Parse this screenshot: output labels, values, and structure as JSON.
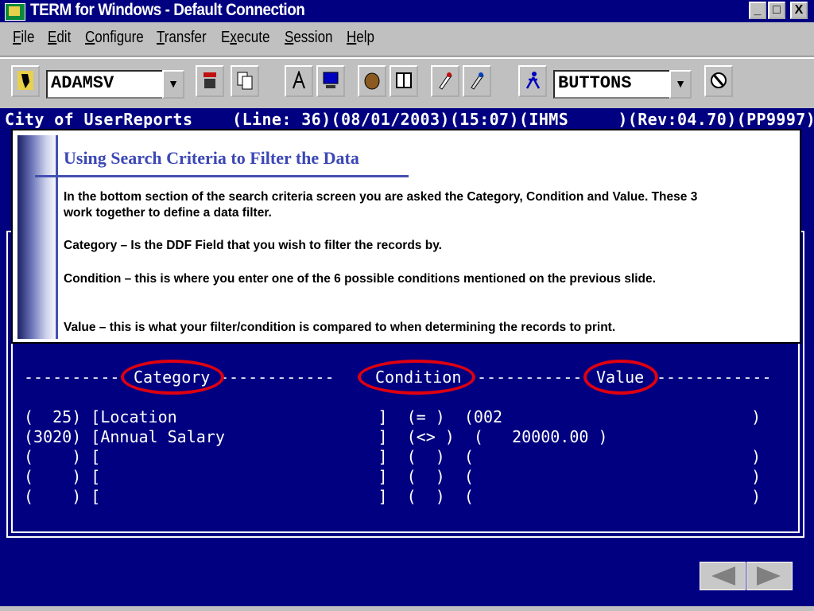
{
  "window": {
    "title": "TERM for Windows - Default Connection",
    "controls": {
      "minimize": "_",
      "maximize": "□",
      "close": "X"
    }
  },
  "menu": [
    {
      "underline": "F",
      "rest": "ile"
    },
    {
      "underline": "E",
      "rest": "dit"
    },
    {
      "underline": "C",
      "rest": "onfigure"
    },
    {
      "underline": "T",
      "rest": "ransfer"
    },
    {
      "pre": "E",
      "underline": "x",
      "rest": "ecute"
    },
    {
      "underline": "S",
      "rest": "ession"
    },
    {
      "underline": "H",
      "rest": "elp"
    }
  ],
  "toolbar": {
    "connection_value": "ADAMSV",
    "buttons_value": "BUTTONS",
    "dropdown_glyph": "▼"
  },
  "terminal": {
    "status_line": "City of UserReports    (Line: 36)(08/01/2003)(15:07)(IHMS     )(Rev:04.70)(PP9997)",
    "header_left_dashes": "----------",
    "header_category": "Category",
    "header_mid_dashes": "------------",
    "header_condition": "Condition",
    "header_condition_dashes": "-----------",
    "header_value": "Value",
    "header_right_dashes": "------------",
    "rows": [
      "(  25) [Location                     ]  (= )  (002                          )",
      "(3020) [Annual Salary                ]  (<> )  (   20000.00 )",
      "(    ) [                             ]  (  )  (                             )",
      "(    ) [                             ]  (  )  (                             )",
      "(    ) [                             ]  (  )  (                             )"
    ]
  },
  "slide": {
    "heading": "Using Search Criteria to Filter the Data",
    "p1": "In the bottom section of the search criteria screen you are asked the Category, Condition and Value.   These 3 work together to define a data filter.",
    "p2": "Category – Is the DDF Field that you wish to filter the records by.",
    "p3": "Condition – this is where you enter one of the 6 possible conditions mentioned on the previous slide.",
    "p4": "Value – this is what your filter/condition is compared to when determining the records to print."
  },
  "colors": {
    "terminal_bg": "#000080",
    "highlight_oval": "#e00010",
    "slide_heading": "#3b48b5"
  }
}
